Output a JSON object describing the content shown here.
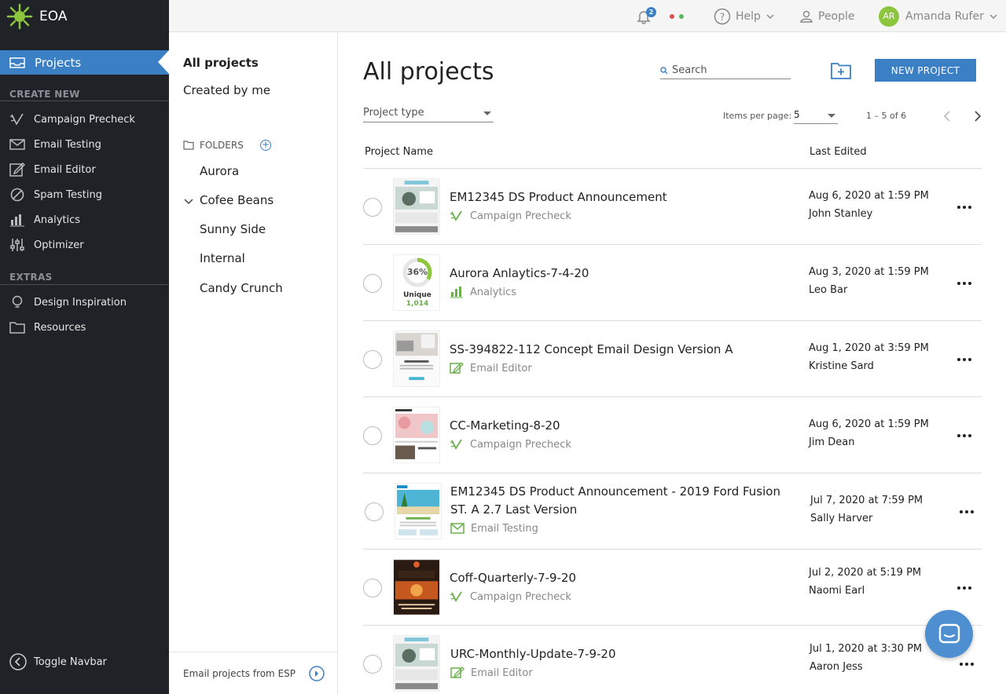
{
  "app": {
    "name": "EOA"
  },
  "nav": {
    "active": "Projects",
    "create_new_heading": "CREATE NEW",
    "create_new": [
      {
        "label": "Campaign Precheck",
        "icon": "precheck-icon"
      },
      {
        "label": "Email Testing",
        "icon": "envelope-icon"
      },
      {
        "label": "Email Editor",
        "icon": "edit-icon"
      },
      {
        "label": "Spam Testing",
        "icon": "ban-icon"
      },
      {
        "label": "Analytics",
        "icon": "bar-chart-icon"
      },
      {
        "label": "Optimizer",
        "icon": "sliders-icon"
      }
    ],
    "extras_heading": "EXTRAS",
    "extras": [
      {
        "label": "Design Inspiration",
        "icon": "lightbulb-icon"
      },
      {
        "label": "Resources",
        "icon": "folder-icon"
      }
    ],
    "toggle_label": "Toggle Navbar"
  },
  "topbar": {
    "notification_count": "2",
    "help_label": "Help",
    "people_label": "People",
    "user_initials": "AR",
    "user_name": "Amanda Rufer",
    "status_colors": [
      "#d9534f",
      "#5cb85c"
    ]
  },
  "folders_panel": {
    "all_projects": "All projects",
    "created_by_me": "Created by me",
    "folders_heading": "FOLDERS",
    "folders": [
      "Aurora",
      "Cofee Beans",
      "Sunny Side",
      "Internal",
      "Candy Crunch"
    ],
    "footer_label": "Email projects from ESP"
  },
  "main": {
    "title": "All projects",
    "search_placeholder": "Search",
    "new_project_label": "NEW PROJECT",
    "project_type_label": "Project type",
    "items_per_page_label": "Items per page:",
    "items_per_page_value": "5",
    "range_label": "1 – 5 of 6",
    "col_name": "Project Name",
    "col_edited": "Last Edited",
    "accent_color": "#3b7fc4",
    "rows": [
      {
        "name": "EM12345 DS Product Announcement",
        "type": "Campaign Precheck",
        "type_icon": "precheck-icon",
        "date": "Aug 6, 2020 at 1:59 PM",
        "author": "John Stanley"
      },
      {
        "name": "Aurora Anlaytics-7-4-20",
        "type": "Analytics",
        "type_icon": "bar-chart-icon",
        "date": "Aug 3, 2020 at 1:59 PM",
        "author": "Leo Bar",
        "thumb_percent": "36%",
        "thumb_label": "Unique",
        "thumb_value": "1,014"
      },
      {
        "name": "SS-394822-112 Concept Email Design Version A",
        "type": "Email Editor",
        "type_icon": "edit-icon",
        "date": "Aug 1, 2020 at 3:59 PM",
        "author": "Kristine Sard"
      },
      {
        "name": "CC-Marketing-8-20",
        "type": "Campaign Precheck",
        "type_icon": "precheck-icon",
        "date": "Aug 6, 2020 at 1:59 PM",
        "author": "Jim Dean"
      },
      {
        "name": "EM12345 DS Product Announcement - 2019 Ford Fusion ST. A 2.7 Last Version",
        "type": "Email Testing",
        "type_icon": "envelope-icon",
        "date": "Jul 7, 2020 at 7:59 PM",
        "author": "Sally Harver"
      },
      {
        "name": "Coff-Quarterly-7-9-20",
        "type": "Campaign Precheck",
        "type_icon": "precheck-icon",
        "date": "Jul 2, 2020 at 5:19 PM",
        "author": "Naomi Earl"
      },
      {
        "name": "URC-Monthly-Update-7-9-20",
        "type": "Email Editor",
        "type_icon": "edit-icon",
        "date": "Jul 1, 2020 at 3:30 PM",
        "author": "Aaron Jess"
      }
    ]
  }
}
